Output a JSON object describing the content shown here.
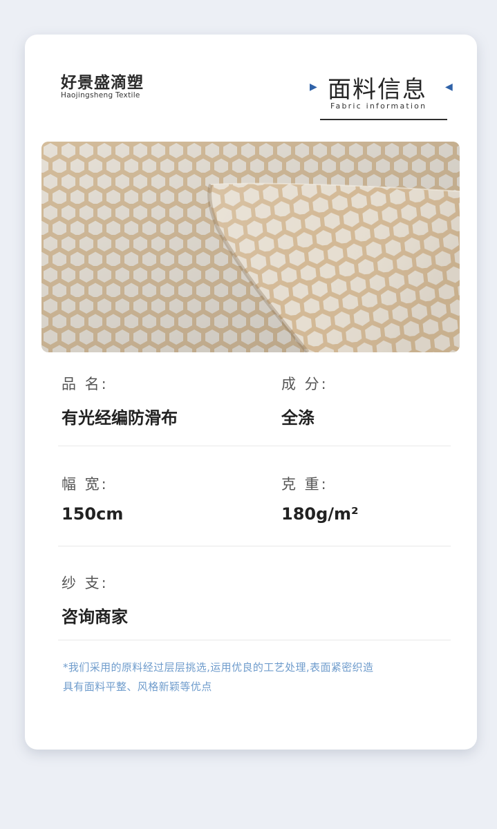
{
  "brand": {
    "name_cn": "好景盛滴塑",
    "name_en": "Haojingsheng Textile"
  },
  "header": {
    "title_cn": "面料信息",
    "title_en": "Fabric information",
    "arrow_left": "▶",
    "arrow_right": "◀",
    "accent_color": "#2f62a8"
  },
  "fabric_image": {
    "icon": "hexagon-pattern-fabric",
    "colors": {
      "base": "#d9c2a2",
      "hex": "#ece7df"
    }
  },
  "specs": {
    "name": {
      "label": "品 名:",
      "value": "有光经编防滑布"
    },
    "composition": {
      "label": "成 分:",
      "value": "全涤"
    },
    "width": {
      "label": "幅 宽:",
      "value": "150cm"
    },
    "weight": {
      "label": "克 重:",
      "value": "180g/m²"
    },
    "yarn": {
      "label": "纱 支:",
      "value": "咨询商家"
    }
  },
  "note": {
    "line1": "*我们采用的原料经过层层挑选,运用优良的工艺处理,表面紧密织造",
    "line2": "具有面料平整、风格新颖等优点",
    "color": "#6f9ccc"
  }
}
